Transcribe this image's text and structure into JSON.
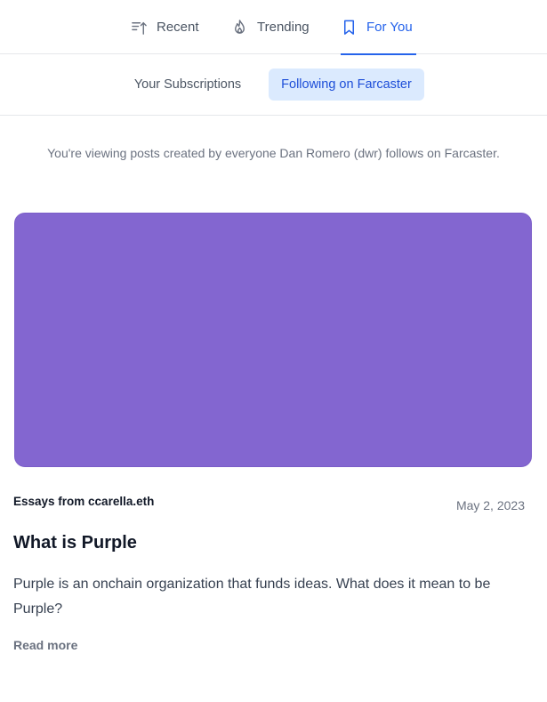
{
  "tabs": {
    "recent": {
      "label": "Recent",
      "icon": "sort-ascending-icon"
    },
    "trending": {
      "label": "Trending",
      "icon": "fire-icon"
    },
    "for_you": {
      "label": "For You",
      "icon": "bookmark-icon",
      "active": true
    }
  },
  "subtabs": {
    "subscriptions": {
      "label": "Your Subscriptions"
    },
    "farcaster": {
      "label": "Following on Farcaster",
      "active": true
    }
  },
  "notice": "You're viewing posts created by everyone Dan Romero (dwr) follows on Farcaster.",
  "post": {
    "image_color": "#8366d0",
    "publication": "Essays from ccarella.eth",
    "date": "May 2, 2023",
    "title": "What is Purple",
    "excerpt": "Purple is an onchain organization that funds ideas. What does it mean to be Purple?",
    "read_more": "Read more"
  },
  "colors": {
    "accent": "#2563eb",
    "accent_bg": "#dbeafe"
  }
}
